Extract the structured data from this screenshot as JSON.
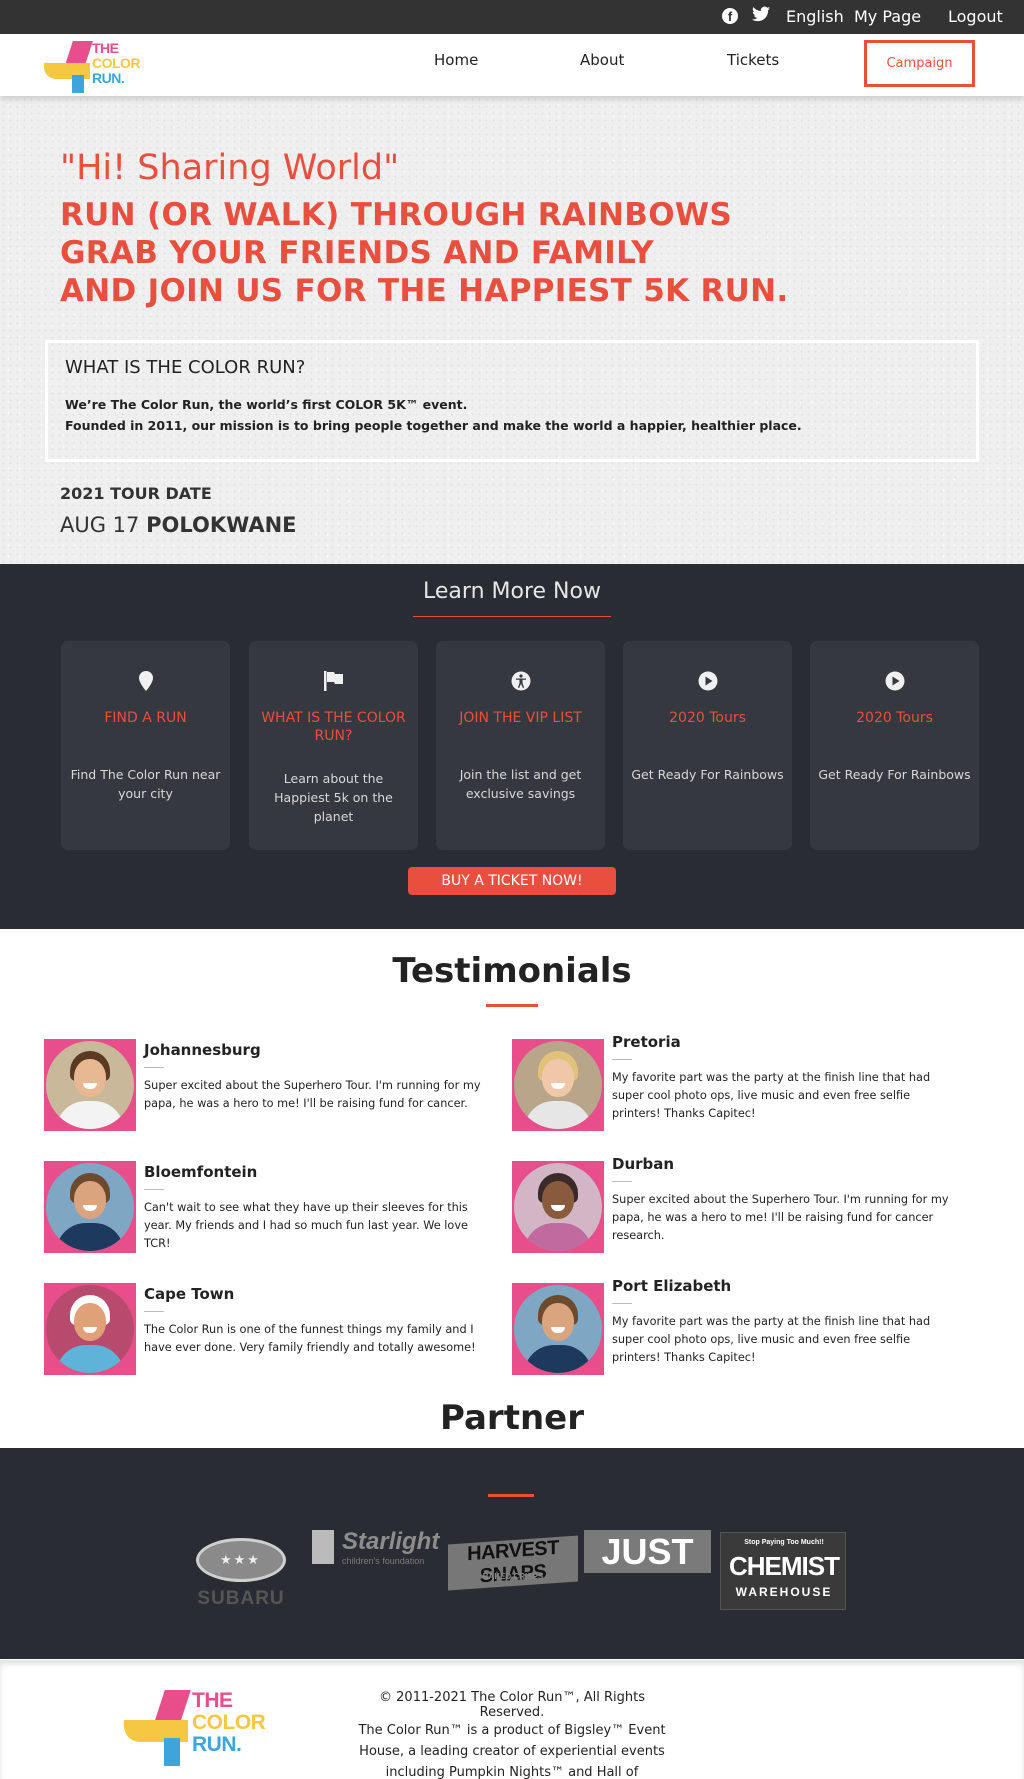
{
  "topbar": {
    "social": [
      "facebook-icon",
      "twitter-icon"
    ],
    "language": "English",
    "my_page": "My Page",
    "logout": "Logout"
  },
  "header": {
    "logo_lines": [
      "THE",
      "COLOR",
      "RUN."
    ],
    "nav": [
      "Home",
      "About",
      "Tickets"
    ],
    "campaign": "Campaign"
  },
  "hero": {
    "quote": "\"Hi! Sharing World\"",
    "lines": [
      "RUN (OR WALK) THROUGH RAINBOWS",
      "GRAB YOUR FRIENDS AND FAMILY",
      "AND JOIN US FOR THE HAPPIEST 5K RUN."
    ],
    "what_title": "WHAT IS THE COLOR RUN?",
    "what_text": [
      "We’re The Color Run, the world’s first COLOR 5K™ event.",
      "Founded in 2011, our mission is to bring people together and make the world a happier, healthier place."
    ],
    "tour_heading": "2021 TOUR DATE",
    "tour_date": "AUG 17",
    "tour_city": "POLOKWANE"
  },
  "learn": {
    "title": "Learn More Now",
    "cards": [
      {
        "icon": "map-pin-icon",
        "title": "FIND A RUN",
        "desc": "Find The Color Run near your city"
      },
      {
        "icon": "flag-icon",
        "title": "WHAT IS THE COLOR RUN?",
        "desc": "Learn about the Happiest 5k on the planet"
      },
      {
        "icon": "accessibility-icon",
        "title": "JOIN THE VIP LIST",
        "desc": "Join the list and get exclusive savings"
      },
      {
        "icon": "play-icon",
        "title": "2020 Tours",
        "desc": "Get Ready For Rainbows"
      },
      {
        "icon": "play-icon",
        "title": "2020 Tours",
        "desc": "Get Ready For Rainbows"
      }
    ],
    "button": "BUY A TICKET NOW!"
  },
  "testimonials": {
    "title": "Testimonials",
    "items": [
      {
        "city": "Johannesburg",
        "text": "Super excited about the Superhero Tour. I'm running for my papa, he was a hero to me! I'll be raising fund for cancer."
      },
      {
        "city": "Pretoria",
        "text": "My favorite part was the party at the finish line that had super cool photo ops, live music and even free selfie printers! Thanks Capitec!"
      },
      {
        "city": "Bloemfontein",
        "text": "Can't wait to see what they have up their sleeves for this year. My friends and I had so much fun last year. We love TCR!"
      },
      {
        "city": "Durban",
        "text": "Super excited about the Superhero Tour. I'm running for my papa, he was a hero to me! I'll be raising fund for cancer research."
      },
      {
        "city": "Cape Town",
        "text": "The Color Run is one of the funnest things my family and I have ever done. Very family friendly and totally awesome!"
      },
      {
        "city": "Port Elizabeth",
        "text": "My favorite part was the party at the finish line that had super cool photo ops, live music and even free selfie printers! Thanks Capitec!"
      }
    ]
  },
  "partner": {
    "title": "Partner",
    "logos": [
      "SUBARU",
      "Starlight",
      "children's foundation",
      "HARVEST SNAPS",
      "BAKED CRISPS",
      "JUST",
      "Stop Paying Too Much!!",
      "CHEMIST",
      "WAREHOUSE"
    ]
  },
  "footer": {
    "logo_lines": [
      "THE",
      "COLOR",
      "RUN."
    ],
    "copyright": "© 2011-2021 The Color Run™, All Rights Reserved.",
    "description": "The Color Run™ is a product of Bigsley™ Event House, a leading creator of experiential events including Pumpkin Nights™ and Hall of Breakfast™."
  },
  "colors": {
    "accent": "#e94f3e",
    "dark_band": "#2a2c33",
    "card": "#363840",
    "logo_pink": "#e84e8a",
    "logo_yellow": "#f6c743",
    "logo_blue": "#3da5dc"
  }
}
